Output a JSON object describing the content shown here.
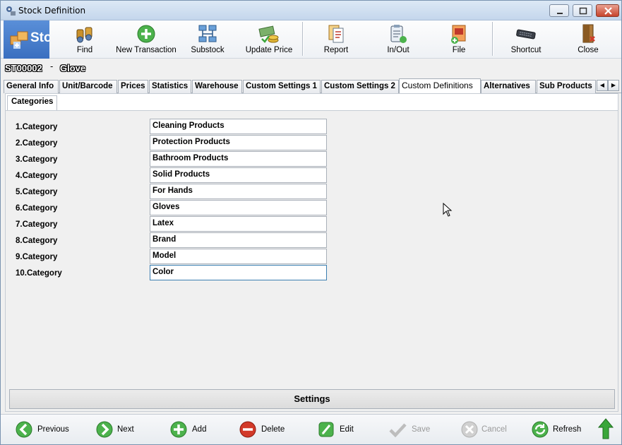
{
  "window": {
    "title": "Stock Definition"
  },
  "toolbar": {
    "module_label": "Stock",
    "buttons": [
      {
        "label": "Find",
        "icon": "binoculars-icon"
      },
      {
        "label": "New Transaction",
        "icon": "add-icon"
      },
      {
        "label": "Substock",
        "icon": "network-icon"
      },
      {
        "label": "Update Price",
        "icon": "money-icon"
      },
      {
        "label": "Report",
        "icon": "report-icon"
      },
      {
        "label": "In/Out",
        "icon": "clipboard-icon"
      },
      {
        "label": "File",
        "icon": "file-icon"
      },
      {
        "label": "Shortcut",
        "icon": "keyboard-icon"
      },
      {
        "label": "Close",
        "icon": "door-icon"
      }
    ]
  },
  "record": {
    "code": "ST00002",
    "separator": "-",
    "name": "Glove"
  },
  "tabs": [
    {
      "label": "General Info"
    },
    {
      "label": "Unit/Barcode"
    },
    {
      "label": "Prices"
    },
    {
      "label": "Statistics"
    },
    {
      "label": "Warehouse"
    },
    {
      "label": "Custom Settings 1"
    },
    {
      "label": "Custom Settings 2"
    },
    {
      "label": "Custom Definitions",
      "active": true
    },
    {
      "label": "Alternatives"
    },
    {
      "label": "Sub Products"
    }
  ],
  "subtab": {
    "label": "Categories"
  },
  "categories": [
    {
      "label": "1.Category",
      "value": "Cleaning Products"
    },
    {
      "label": "2.Category",
      "value": "Protection Products"
    },
    {
      "label": "3.Category",
      "value": "Bathroom Products"
    },
    {
      "label": "4.Category",
      "value": "Solid Products"
    },
    {
      "label": "5.Category",
      "value": "For Hands"
    },
    {
      "label": "6.Category",
      "value": "Gloves"
    },
    {
      "label": "7.Category",
      "value": "Latex"
    },
    {
      "label": "8.Category",
      "value": "Brand"
    },
    {
      "label": "9.Category",
      "value": "Model"
    },
    {
      "label": "10.Category",
      "value": "Color"
    }
  ],
  "settings_label": "Settings",
  "bottom": {
    "previous": "Previous",
    "next": "Next",
    "add": "Add",
    "delete": "Delete",
    "edit": "Edit",
    "save": "Save",
    "cancel": "Cancel",
    "refresh": "Refresh"
  },
  "colors": {
    "accent_blue": "#3a6fc0",
    "green": "#3aa63a",
    "red": "#d23a2a"
  }
}
